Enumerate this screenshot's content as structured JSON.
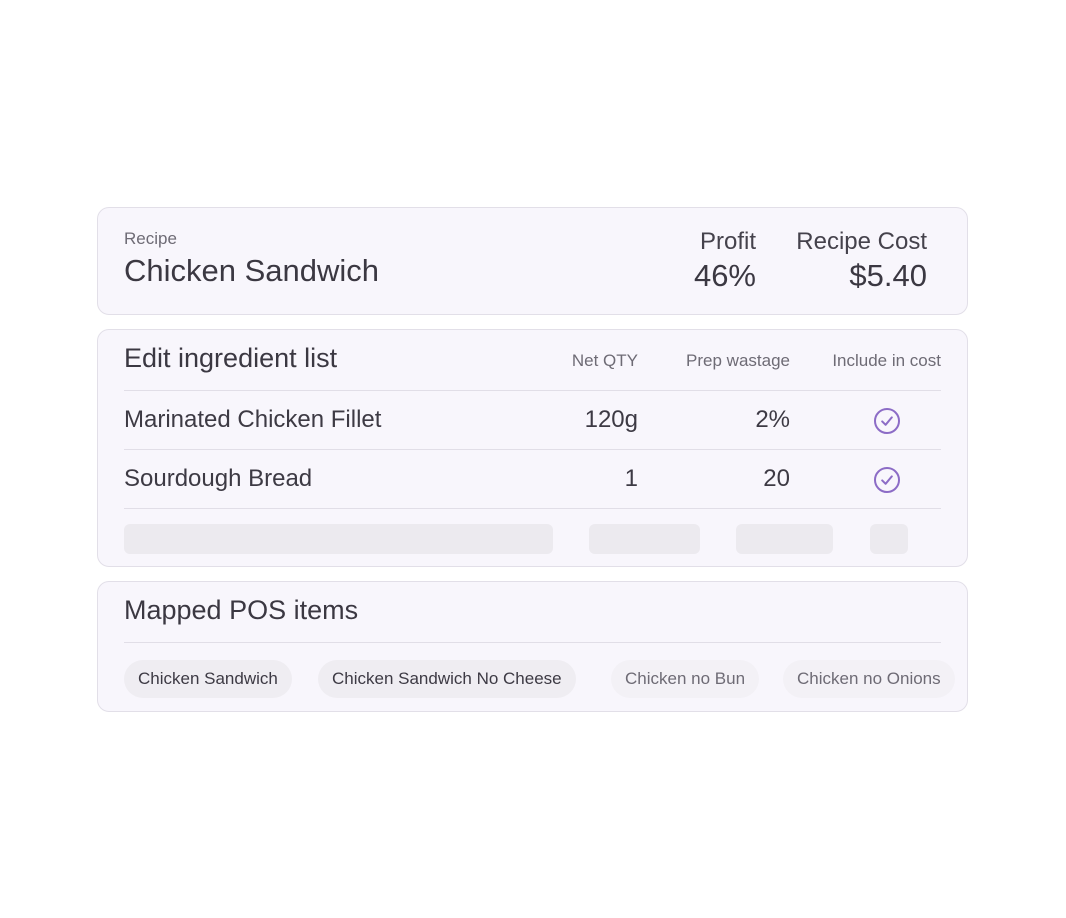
{
  "recipe": {
    "label": "Recipe",
    "name": "Chicken Sandwich",
    "profit_label": "Profit",
    "profit_value": "46%",
    "cost_label": "Recipe Cost",
    "cost_value": "$5.40"
  },
  "ingredients": {
    "title": "Edit ingredient list",
    "columns": [
      "Net QTY",
      "Prep wastage",
      "Include in cost"
    ],
    "rows": [
      {
        "name": "Marinated Chicken Fillet",
        "qty": "120g",
        "wastage": "2%",
        "include_in_cost": true
      },
      {
        "name": "Sourdough Bread",
        "qty": "1",
        "wastage": "20",
        "include_in_cost": true
      }
    ]
  },
  "pos": {
    "title": "Mapped POS items",
    "items": [
      "Chicken Sandwich",
      "Chicken Sandwich No Cheese",
      "Chicken no Bun",
      "Chicken no Onions"
    ]
  },
  "colors": {
    "accent": "#8c6cc6",
    "card_bg": "#f8f6fc",
    "border": "#e2dfe8"
  },
  "icons": {
    "include_check": "check-circle-icon"
  }
}
